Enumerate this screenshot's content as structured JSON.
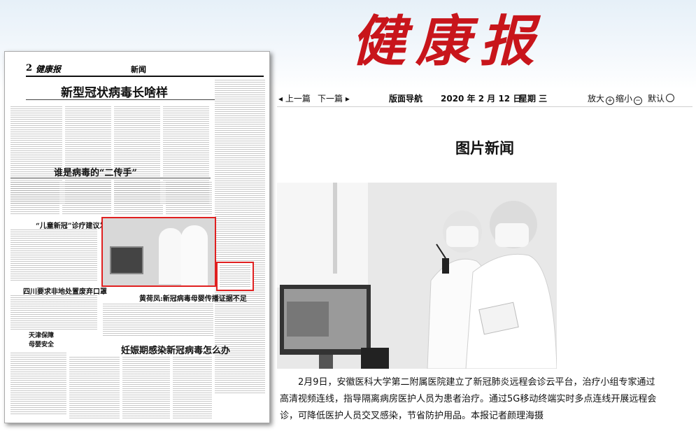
{
  "masthead": "健康报",
  "paper": {
    "page_number": "2",
    "paper_name": "健康报",
    "section": "新闻",
    "headlines": {
      "main": "新型冠状病毒长啥样",
      "second": "谁是病毒的“二传手”",
      "third": "“儿童新冠”诊疗建议发布",
      "fourth": "四川要求非地处置废弃口罩",
      "fifth": "黄荷凤:新冠病毒母婴传播证据不足",
      "sixth": "天津保障母婴安全",
      "seventh": "妊娠期感染新冠病毒怎么办"
    }
  },
  "nav": {
    "prev": "上一篇",
    "next": "下一篇",
    "guide": "版面导航",
    "date": "2020 年 2 月 12 日",
    "weekday": "星期 三",
    "zoom_in": "放大",
    "zoom_out": "缩小",
    "default": "默认"
  },
  "section_title": "图片新闻",
  "article": "2月9日，安徽医科大学第二附属医院建立了新冠肺炎远程会诊云平台，治疗小组专家通过高清视频连线，指导隔离病房医护人员为患者治疗。通过5G移动终端实时多点连线开展远程会诊，可降低医护人员交叉感染，节省防护用品。本报记者颜理海摄"
}
